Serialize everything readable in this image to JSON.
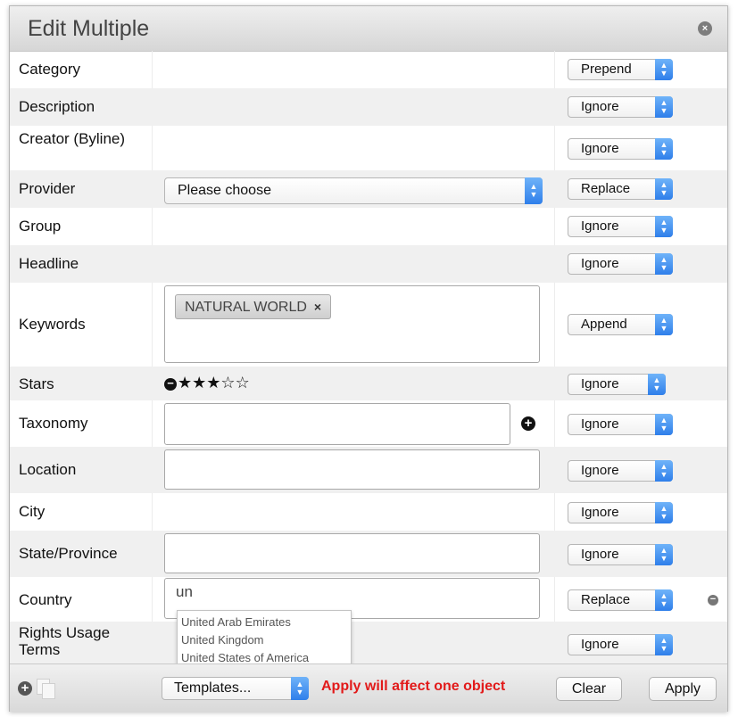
{
  "dialog": {
    "title": "Edit Multiple"
  },
  "fields": [
    {
      "label": "Category",
      "mode": "Prepend"
    },
    {
      "label": "Description",
      "mode": "Ignore"
    },
    {
      "label": "Creator (Byline)",
      "mode": "Ignore"
    },
    {
      "label": "Provider",
      "mode": "Replace",
      "select_value": "Please choose"
    },
    {
      "label": "Group",
      "mode": "Ignore"
    },
    {
      "label": "Headline",
      "mode": "Ignore"
    },
    {
      "label": "Keywords",
      "mode": "Append",
      "tokens": [
        "NATURAL WORLD"
      ]
    },
    {
      "label": "Stars",
      "mode": "Ignore",
      "rating": 3,
      "max": 6
    },
    {
      "label": "Taxonomy",
      "mode": "Ignore"
    },
    {
      "label": "Location",
      "mode": "Ignore"
    },
    {
      "label": "City",
      "mode": "Ignore"
    },
    {
      "label": "State/Province",
      "mode": "Ignore"
    },
    {
      "label": "Country",
      "mode": "Replace",
      "value": "un"
    },
    {
      "label": "Rights Usage Terms",
      "mode": "Ignore"
    }
  ],
  "country_suggestions": [
    "United Arab Emirates",
    "United Kingdom",
    "United States of America"
  ],
  "icons": {
    "close": "close-icon",
    "token_remove": "×",
    "add": "+",
    "remove": "−",
    "star_full": "★",
    "star_empty": "☆"
  },
  "footer": {
    "templates_label": "Templates...",
    "apply_message": "Apply will affect one object",
    "clear_label": "Clear",
    "apply_label": "Apply"
  },
  "colors": {
    "accent": "#3b88f0",
    "warning": "#e21a1a"
  }
}
